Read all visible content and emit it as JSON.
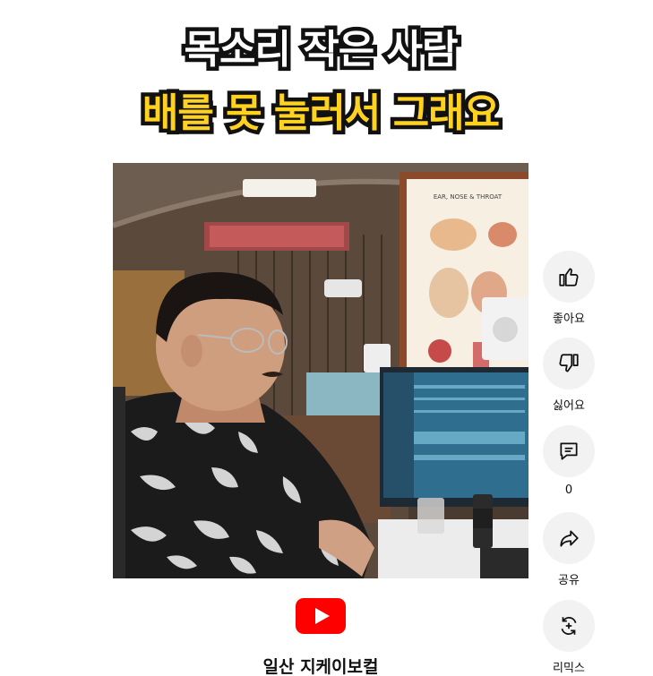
{
  "short": {
    "title_line_1": "목소리 작은 사람",
    "title_line_2": "배를 못 눌러서 그래요",
    "chart_poster_title": "EAR, NOSE & THROAT",
    "channel_name": "일산 지케이보컬"
  },
  "actions": {
    "like_label": "좋아요",
    "dislike_label": "싫어요",
    "comments_count": "0",
    "share_label": "공유",
    "remix_label": "리믹스"
  },
  "colors": {
    "title_highlight": "#ffd21f",
    "youtube_red": "#ff0000",
    "button_bg": "#f2f2f2"
  },
  "icons": [
    "thumbs-up-icon",
    "thumbs-down-icon",
    "comment-icon",
    "share-icon",
    "remix-icon",
    "youtube-logo"
  ]
}
